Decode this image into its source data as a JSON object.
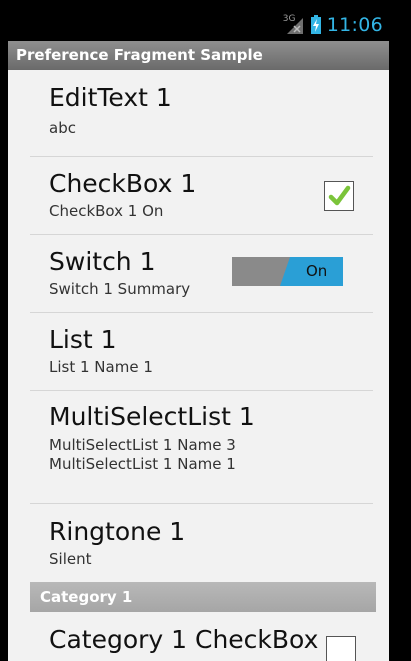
{
  "status_bar": {
    "network": "3G",
    "time": "11:06"
  },
  "app_bar": {
    "title": "Preference Fragment Sample"
  },
  "preferences": [
    {
      "title": "EditText 1",
      "summary": "abc"
    },
    {
      "title": "CheckBox 1",
      "summary": "CheckBox 1 On",
      "checked": true
    },
    {
      "title": "Switch 1",
      "summary": "Switch 1 Summary",
      "switch_label": "On",
      "switch_on": true
    },
    {
      "title": "List 1",
      "summary": "List 1 Name 1"
    },
    {
      "title": "MultiSelectList 1",
      "summary_lines": [
        "MultiSelectList 1 Name 3",
        "MultiSelectList 1 Name 1"
      ]
    },
    {
      "title": "Ringtone 1",
      "summary": "Silent"
    }
  ],
  "category": {
    "header": "Category 1",
    "items": [
      {
        "title": "Category 1 CheckBox",
        "checked": false
      }
    ]
  },
  "colors": {
    "accent": "#33b5e5",
    "switch_on": "#2a9fd6",
    "check": "#7bc43a"
  }
}
